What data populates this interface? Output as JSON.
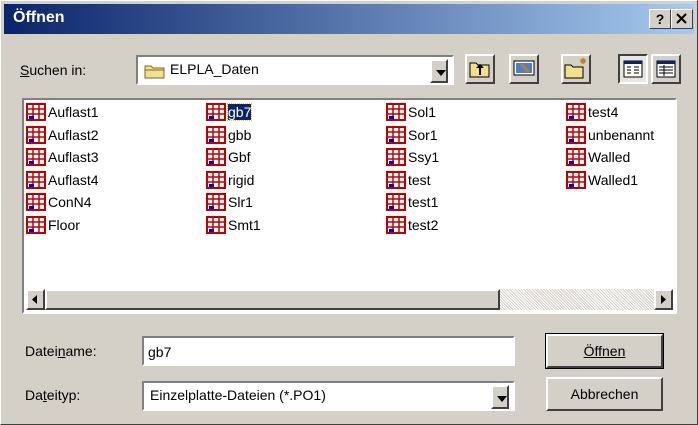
{
  "window": {
    "title": "Öffnen",
    "help_label": "?",
    "close_label": "X"
  },
  "lookin": {
    "label": "Suchen in:",
    "value": "ELPLA_Daten"
  },
  "toolbar": {
    "up_icon": "up-folder-icon",
    "desktop_icon": "desktop-icon",
    "newfolder_icon": "new-folder-icon",
    "list_icon": "list-view-icon",
    "details_icon": "details-view-icon"
  },
  "files": {
    "col1": [
      "Auflast1",
      "Auflast2",
      "Auflast3",
      "Auflast4",
      "ConN4",
      "Floor"
    ],
    "col2": [
      "gb7",
      "gbb",
      "Gbf",
      "rigid",
      "Slr1",
      "Smt1"
    ],
    "col3": [
      "Sol1",
      "Sor1",
      "Ssy1",
      "test",
      "test1",
      "test2"
    ],
    "col4": [
      "test4",
      "unbenannt",
      "Walled",
      "Walled1"
    ],
    "selected": "gb7"
  },
  "filename": {
    "label": "Dateiname:",
    "value": "gb7"
  },
  "filetype": {
    "label": "Dateityp:",
    "value": "Einzelplatte-Dateien (*.PO1)"
  },
  "buttons": {
    "open": "Öffnen",
    "cancel": "Abbrechen"
  },
  "colors": {
    "title_start": "#0a246a",
    "title_end": "#a6caf0",
    "dialog_bg": "#d4d0c8",
    "selection": "#0a246a"
  }
}
